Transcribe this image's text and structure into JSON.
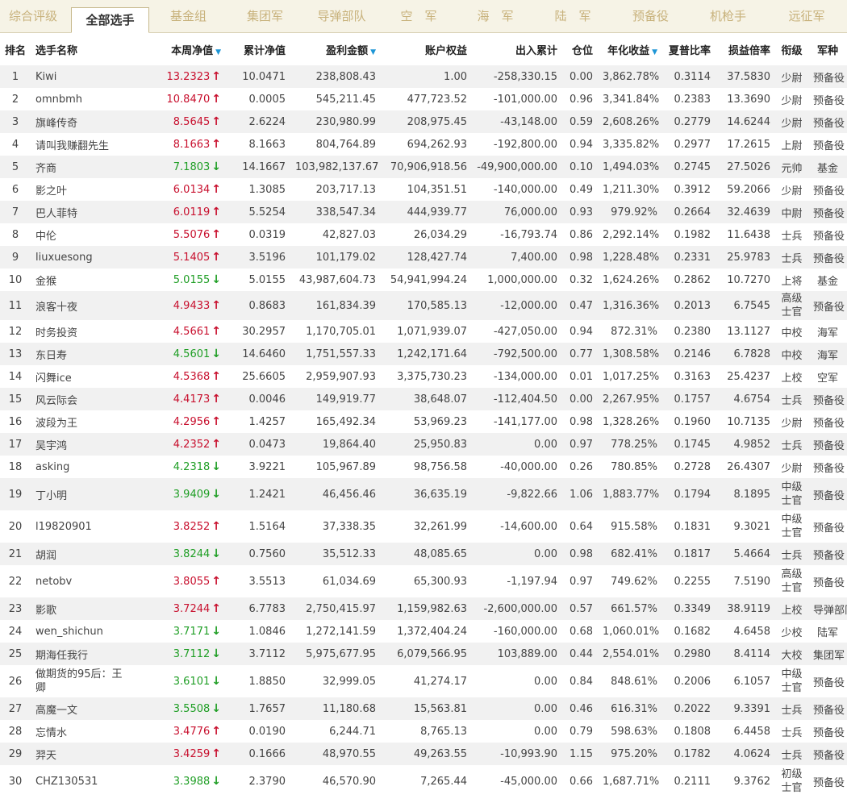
{
  "colors": {
    "up": "#c8102e",
    "down": "#1f9e25",
    "tab_inactive": "#c8b27c",
    "row_alt": "#f1f1f1",
    "sort_icon": "#1e96d6"
  },
  "tabs": [
    {
      "label": "综合评级",
      "active": false
    },
    {
      "label": "全部选手",
      "active": true
    },
    {
      "label": "基金组",
      "active": false
    },
    {
      "label": "集团军",
      "active": false
    },
    {
      "label": "导弹部队",
      "active": false
    },
    {
      "label": "空　军",
      "active": false
    },
    {
      "label": "海　军",
      "active": false
    },
    {
      "label": "陆　军",
      "active": false
    },
    {
      "label": "预备役",
      "active": false
    },
    {
      "label": "机枪手",
      "active": false
    },
    {
      "label": "远征军",
      "active": false
    }
  ],
  "table": {
    "headers": {
      "rank": "排名",
      "name": "选手名称",
      "nav": "本周净值",
      "cum_nav": "累计净值",
      "profit": "盈利金额",
      "equity": "账户权益",
      "flow": "出入累计",
      "position": "仓位",
      "annual": "年化收益",
      "sharpe": "夏普比率",
      "loss_ratio": "损益倍率",
      "title": "衔级",
      "branch": "军种"
    },
    "sort_icon": "sort-down-icon",
    "rows": [
      {
        "rank": "1",
        "name": "Kiwi",
        "nav": "13.2323",
        "trend": "up",
        "cum_nav": "10.0471",
        "profit": "238,808.43",
        "equity": "1.00",
        "flow": "-258,330.15",
        "position": "0.00",
        "annual": "3,862.78%",
        "sharpe": "0.3114",
        "loss_ratio": "37.5830",
        "title": "少尉",
        "branch": "预备役"
      },
      {
        "rank": "2",
        "name": "omnbmh",
        "nav": "10.8470",
        "trend": "up",
        "cum_nav": "0.0005",
        "profit": "545,211.45",
        "equity": "477,723.52",
        "flow": "-101,000.00",
        "position": "0.96",
        "annual": "3,341.84%",
        "sharpe": "0.2383",
        "loss_ratio": "13.3690",
        "title": "少尉",
        "branch": "预备役"
      },
      {
        "rank": "3",
        "name": "旗峰传奇",
        "nav": "8.5645",
        "trend": "up",
        "cum_nav": "2.6224",
        "profit": "230,980.99",
        "equity": "208,975.45",
        "flow": "-43,148.00",
        "position": "0.59",
        "annual": "2,608.26%",
        "sharpe": "0.2779",
        "loss_ratio": "14.6244",
        "title": "少尉",
        "branch": "预备役"
      },
      {
        "rank": "4",
        "name": "请叫我赚翻先生",
        "nav": "8.1663",
        "trend": "up",
        "cum_nav": "8.1663",
        "profit": "804,764.89",
        "equity": "694,262.93",
        "flow": "-192,800.00",
        "position": "0.94",
        "annual": "3,335.82%",
        "sharpe": "0.2977",
        "loss_ratio": "17.2615",
        "title": "上尉",
        "branch": "预备役"
      },
      {
        "rank": "5",
        "name": "齐商",
        "nav": "7.1803",
        "trend": "down",
        "cum_nav": "14.1667",
        "profit": "103,982,137.67",
        "equity": "70,906,918.56",
        "flow": "-49,900,000.00",
        "position": "0.10",
        "annual": "1,494.03%",
        "sharpe": "0.2745",
        "loss_ratio": "27.5026",
        "title": "元帅",
        "branch": "基金"
      },
      {
        "rank": "6",
        "name": "影之叶",
        "nav": "6.0134",
        "trend": "up",
        "cum_nav": "1.3085",
        "profit": "203,717.13",
        "equity": "104,351.51",
        "flow": "-140,000.00",
        "position": "0.49",
        "annual": "1,211.30%",
        "sharpe": "0.3912",
        "loss_ratio": "59.2066",
        "title": "少尉",
        "branch": "预备役"
      },
      {
        "rank": "7",
        "name": "巴人菲特",
        "nav": "6.0119",
        "trend": "up",
        "cum_nav": "5.5254",
        "profit": "338,547.34",
        "equity": "444,939.77",
        "flow": "76,000.00",
        "position": "0.93",
        "annual": "979.92%",
        "sharpe": "0.2664",
        "loss_ratio": "32.4639",
        "title": "中尉",
        "branch": "预备役"
      },
      {
        "rank": "8",
        "name": "中伦",
        "nav": "5.5076",
        "trend": "up",
        "cum_nav": "0.0319",
        "profit": "42,827.03",
        "equity": "26,034.29",
        "flow": "-16,793.74",
        "position": "0.86",
        "annual": "2,292.14%",
        "sharpe": "0.1982",
        "loss_ratio": "11.6438",
        "title": "士兵",
        "branch": "预备役"
      },
      {
        "rank": "9",
        "name": "liuxuesong",
        "nav": "5.1405",
        "trend": "up",
        "cum_nav": "3.5196",
        "profit": "101,179.02",
        "equity": "128,427.74",
        "flow": "7,400.00",
        "position": "0.98",
        "annual": "1,228.48%",
        "sharpe": "0.2331",
        "loss_ratio": "25.9783",
        "title": "士兵",
        "branch": "预备役"
      },
      {
        "rank": "10",
        "name": "金猴",
        "nav": "5.0155",
        "trend": "down",
        "cum_nav": "5.0155",
        "profit": "43,987,604.73",
        "equity": "54,941,994.24",
        "flow": "1,000,000.00",
        "position": "0.32",
        "annual": "1,624.26%",
        "sharpe": "0.2862",
        "loss_ratio": "10.7270",
        "title": "上将",
        "branch": "基金"
      },
      {
        "rank": "11",
        "name": "浪客十夜",
        "nav": "4.9433",
        "trend": "up",
        "cum_nav": "0.8683",
        "profit": "161,834.39",
        "equity": "170,585.13",
        "flow": "-12,000.00",
        "position": "0.47",
        "annual": "1,316.36%",
        "sharpe": "0.2013",
        "loss_ratio": "6.7545",
        "title": "高级士官",
        "branch": "预备役"
      },
      {
        "rank": "12",
        "name": "时务投资",
        "nav": "4.5661",
        "trend": "up",
        "cum_nav": "30.2957",
        "profit": "1,170,705.01",
        "equity": "1,071,939.07",
        "flow": "-427,050.00",
        "position": "0.94",
        "annual": "872.31%",
        "sharpe": "0.2380",
        "loss_ratio": "13.1127",
        "title": "中校",
        "branch": "海军"
      },
      {
        "rank": "13",
        "name": "东日寿",
        "nav": "4.5601",
        "trend": "down",
        "cum_nav": "14.6460",
        "profit": "1,751,557.33",
        "equity": "1,242,171.64",
        "flow": "-792,500.00",
        "position": "0.77",
        "annual": "1,308.58%",
        "sharpe": "0.2146",
        "loss_ratio": "6.7828",
        "title": "中校",
        "branch": "海军"
      },
      {
        "rank": "14",
        "name": "闪舞ice",
        "nav": "4.5368",
        "trend": "up",
        "cum_nav": "25.6605",
        "profit": "2,959,907.93",
        "equity": "3,375,730.23",
        "flow": "-134,000.00",
        "position": "0.01",
        "annual": "1,017.25%",
        "sharpe": "0.3163",
        "loss_ratio": "25.4237",
        "title": "上校",
        "branch": "空军"
      },
      {
        "rank": "15",
        "name": "风云际会",
        "nav": "4.4173",
        "trend": "up",
        "cum_nav": "0.0046",
        "profit": "149,919.77",
        "equity": "38,648.07",
        "flow": "-112,404.50",
        "position": "0.00",
        "annual": "2,267.95%",
        "sharpe": "0.1757",
        "loss_ratio": "4.6754",
        "title": "士兵",
        "branch": "预备役"
      },
      {
        "rank": "16",
        "name": "波段为王",
        "nav": "4.2956",
        "trend": "up",
        "cum_nav": "1.4257",
        "profit": "165,492.34",
        "equity": "53,969.23",
        "flow": "-141,177.00",
        "position": "0.98",
        "annual": "1,328.26%",
        "sharpe": "0.1960",
        "loss_ratio": "10.7135",
        "title": "少尉",
        "branch": "预备役"
      },
      {
        "rank": "17",
        "name": "吴宇鸿",
        "nav": "4.2352",
        "trend": "up",
        "cum_nav": "0.0473",
        "profit": "19,864.40",
        "equity": "25,950.83",
        "flow": "0.00",
        "position": "0.97",
        "annual": "778.25%",
        "sharpe": "0.1745",
        "loss_ratio": "4.9852",
        "title": "士兵",
        "branch": "预备役"
      },
      {
        "rank": "18",
        "name": "asking",
        "nav": "4.2318",
        "trend": "down",
        "cum_nav": "3.9221",
        "profit": "105,967.89",
        "equity": "98,756.58",
        "flow": "-40,000.00",
        "position": "0.26",
        "annual": "780.85%",
        "sharpe": "0.2728",
        "loss_ratio": "26.4307",
        "title": "少尉",
        "branch": "预备役"
      },
      {
        "rank": "19",
        "name": "丁小明",
        "nav": "3.9409",
        "trend": "down",
        "cum_nav": "1.2421",
        "profit": "46,456.46",
        "equity": "36,635.19",
        "flow": "-9,822.66",
        "position": "1.06",
        "annual": "1,883.77%",
        "sharpe": "0.1794",
        "loss_ratio": "8.1895",
        "title": "中级士官",
        "branch": "预备役"
      },
      {
        "rank": "20",
        "name": "l19820901",
        "nav": "3.8252",
        "trend": "up",
        "cum_nav": "1.5164",
        "profit": "37,338.35",
        "equity": "32,261.99",
        "flow": "-14,600.00",
        "position": "0.64",
        "annual": "915.58%",
        "sharpe": "0.1831",
        "loss_ratio": "9.3021",
        "title": "中级士官",
        "branch": "预备役"
      },
      {
        "rank": "21",
        "name": "胡润",
        "nav": "3.8244",
        "trend": "down",
        "cum_nav": "0.7560",
        "profit": "35,512.33",
        "equity": "48,085.65",
        "flow": "0.00",
        "position": "0.98",
        "annual": "682.41%",
        "sharpe": "0.1817",
        "loss_ratio": "5.4664",
        "title": "士兵",
        "branch": "预备役"
      },
      {
        "rank": "22",
        "name": "netobv",
        "nav": "3.8055",
        "trend": "up",
        "cum_nav": "3.5513",
        "profit": "61,034.69",
        "equity": "65,300.93",
        "flow": "-1,197.94",
        "position": "0.97",
        "annual": "749.62%",
        "sharpe": "0.2255",
        "loss_ratio": "7.5190",
        "title": "高级士官",
        "branch": "预备役"
      },
      {
        "rank": "23",
        "name": "影歌",
        "nav": "3.7244",
        "trend": "up",
        "cum_nav": "6.7783",
        "profit": "2,750,415.97",
        "equity": "1,159,982.63",
        "flow": "-2,600,000.00",
        "position": "0.57",
        "annual": "661.57%",
        "sharpe": "0.3349",
        "loss_ratio": "38.9119",
        "title": "上校",
        "branch": "导弹部队"
      },
      {
        "rank": "24",
        "name": "wen_shichun",
        "nav": "3.7171",
        "trend": "down",
        "cum_nav": "1.0846",
        "profit": "1,272,141.59",
        "equity": "1,372,404.24",
        "flow": "-160,000.00",
        "position": "0.68",
        "annual": "1,060.01%",
        "sharpe": "0.1682",
        "loss_ratio": "4.6458",
        "title": "少校",
        "branch": "陆军"
      },
      {
        "rank": "25",
        "name": "期海任我行",
        "nav": "3.7112",
        "trend": "down",
        "cum_nav": "3.7112",
        "profit": "5,975,677.95",
        "equity": "6,079,566.95",
        "flow": "103,889.00",
        "position": "0.44",
        "annual": "2,554.01%",
        "sharpe": "0.2980",
        "loss_ratio": "8.4114",
        "title": "大校",
        "branch": "集团军"
      },
      {
        "rank": "26",
        "name": "做期货的95后：王卿",
        "nav": "3.6101",
        "trend": "down",
        "cum_nav": "1.8850",
        "profit": "32,999.05",
        "equity": "41,274.17",
        "flow": "0.00",
        "position": "0.84",
        "annual": "848.61%",
        "sharpe": "0.2006",
        "loss_ratio": "6.1057",
        "title": "中级士官",
        "branch": "预备役"
      },
      {
        "rank": "27",
        "name": "高魔一文",
        "nav": "3.5508",
        "trend": "down",
        "cum_nav": "1.7657",
        "profit": "11,180.68",
        "equity": "15,563.81",
        "flow": "0.00",
        "position": "0.46",
        "annual": "616.31%",
        "sharpe": "0.2022",
        "loss_ratio": "9.3391",
        "title": "士兵",
        "branch": "预备役"
      },
      {
        "rank": "28",
        "name": "忘情水",
        "nav": "3.4776",
        "trend": "up",
        "cum_nav": "0.0190",
        "profit": "6,244.71",
        "equity": "8,765.13",
        "flow": "0.00",
        "position": "0.79",
        "annual": "598.63%",
        "sharpe": "0.1808",
        "loss_ratio": "6.4458",
        "title": "士兵",
        "branch": "预备役"
      },
      {
        "rank": "29",
        "name": "羿天",
        "nav": "3.4259",
        "trend": "up",
        "cum_nav": "0.1666",
        "profit": "48,970.55",
        "equity": "49,263.55",
        "flow": "-10,993.90",
        "position": "1.15",
        "annual": "975.20%",
        "sharpe": "0.1782",
        "loss_ratio": "4.0624",
        "title": "士兵",
        "branch": "预备役"
      },
      {
        "rank": "30",
        "name": "CHZ130531",
        "nav": "3.3988",
        "trend": "down",
        "cum_nav": "2.3790",
        "profit": "46,570.90",
        "equity": "7,265.44",
        "flow": "-45,000.00",
        "position": "0.66",
        "annual": "1,687.71%",
        "sharpe": "0.2111",
        "loss_ratio": "9.3762",
        "title": "初级士官",
        "branch": "预备役"
      }
    ]
  }
}
